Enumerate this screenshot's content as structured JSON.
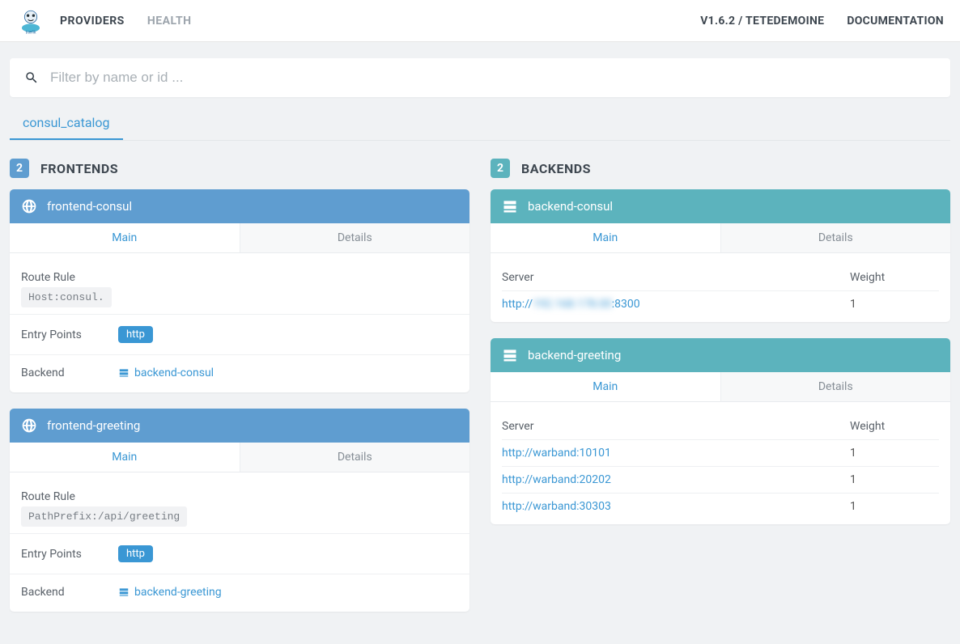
{
  "nav": {
    "providers": "PROVIDERS",
    "health": "HEALTH",
    "version": "V1.6.2 / TETEDEMOINE",
    "documentation": "DOCUMENTATION"
  },
  "search": {
    "placeholder": "Filter by name or id ..."
  },
  "provider_tab": "consul_catalog",
  "frontends": {
    "title": "FRONTENDS",
    "count": "2",
    "tabs": {
      "main": "Main",
      "details": "Details"
    },
    "labels": {
      "route_rule": "Route Rule",
      "entry_points": "Entry Points",
      "backend": "Backend"
    },
    "items": [
      {
        "name": "frontend-consul",
        "route_rule": "Host:consul.",
        "entry_point": "http",
        "backend": "backend-consul"
      },
      {
        "name": "frontend-greeting",
        "route_rule": "PathPrefix:/api/greeting",
        "entry_point": "http",
        "backend": "backend-greeting"
      }
    ]
  },
  "backends": {
    "title": "BACKENDS",
    "count": "2",
    "tabs": {
      "main": "Main",
      "details": "Details"
    },
    "columns": {
      "server": "Server",
      "weight": "Weight"
    },
    "items": [
      {
        "name": "backend-consul",
        "servers": [
          {
            "url_prefix": "http://",
            "url_blur": "192.168.178.00",
            "url_suffix": ":8300",
            "weight": "1"
          }
        ]
      },
      {
        "name": "backend-greeting",
        "servers": [
          {
            "url": "http://warband:10101",
            "weight": "1"
          },
          {
            "url": "http://warband:20202",
            "weight": "1"
          },
          {
            "url": "http://warband:30303",
            "weight": "1"
          }
        ]
      }
    ]
  }
}
